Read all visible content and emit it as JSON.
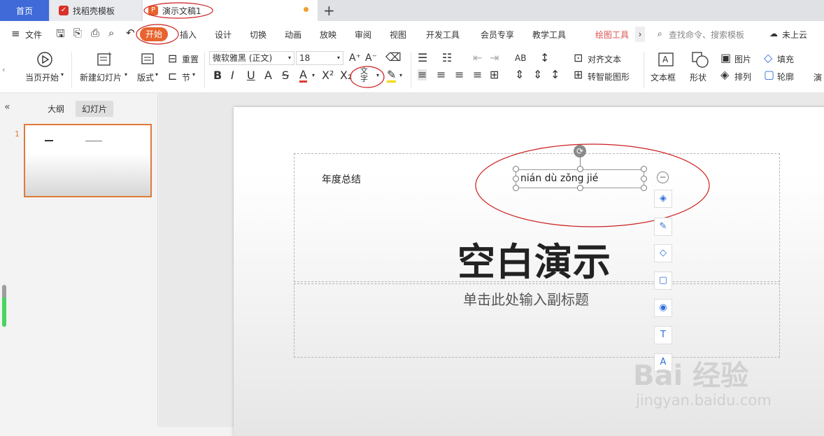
{
  "tabs": {
    "home": "首页",
    "template": "找稻壳模板",
    "document": "演示文稿1",
    "add": "+"
  },
  "menu": {
    "file": "文件",
    "start": "开始",
    "insert": "插入",
    "design": "设计",
    "switch": "切换",
    "animation": "动画",
    "show": "放映",
    "review": "审阅",
    "view": "视图",
    "devtools": "开发工具",
    "member": "会员专享",
    "teaching": "教学工具",
    "drawing": "绘图工具",
    "search": "查找命令、搜索模板",
    "cloud": "未上云"
  },
  "ribbon": {
    "play_from_current": "当页开始",
    "new_slide": "新建幻灯片",
    "layout": "版式",
    "reset": "重置",
    "section": "节",
    "font_name": "微软雅黑 (正文)",
    "font_size": "18",
    "align_text": "对齐文本",
    "smartart": "转智能图形",
    "textbox": "文本框",
    "shape": "形状",
    "picture": "图片",
    "arrange": "排列",
    "fill": "填充",
    "outline": "轮廓",
    "more": "演"
  },
  "left_panel": {
    "outline_tab": "大纲",
    "slides_tab": "幻灯片",
    "slide_number": "1"
  },
  "slide": {
    "text1": "年度总结",
    "pinyin_text": "nián dù zǒng jié",
    "title": "空白演示",
    "subtitle_placeholder": "单击此处输入副标题"
  },
  "watermark": {
    "brand": "Bai 经验",
    "url": "jingyan.baidu.com"
  },
  "colors": {
    "accent_orange": "#e8632e",
    "home_tab_blue": "#3f6ad8",
    "annotation_red": "#cc1f1f",
    "drawing_tools_red": "#d9534f"
  }
}
